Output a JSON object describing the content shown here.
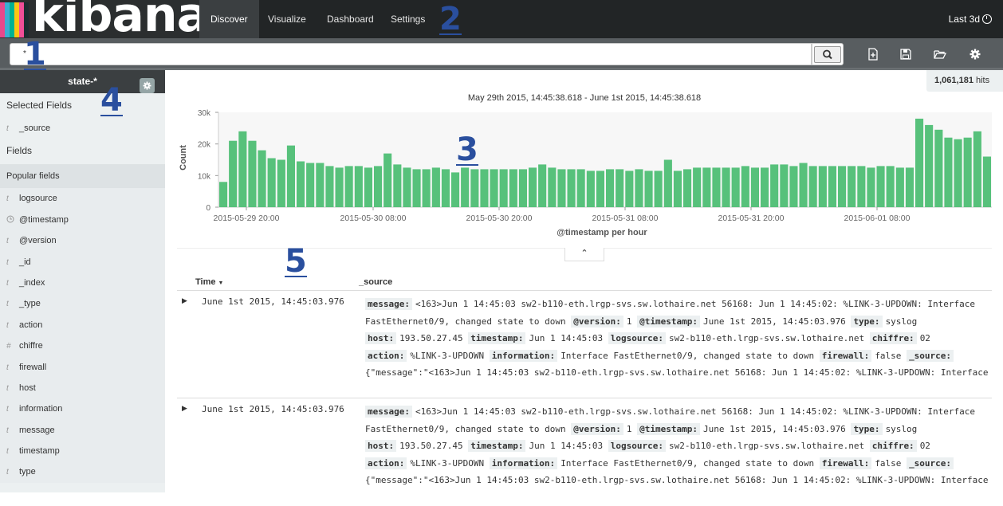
{
  "nav": {
    "logo": "kibana",
    "logo_colors": [
      "#e8488b",
      "#3caed2",
      "#00b294",
      "#fec514",
      "#f04e98",
      "#1e2b31"
    ],
    "tabs": [
      "Discover",
      "Visualize",
      "Dashboard",
      "Settings"
    ],
    "active_tab": "Discover",
    "time_range": "Last 3d"
  },
  "search": {
    "query": "*",
    "button_icon": "search-icon"
  },
  "toolbar": {
    "icons": [
      "new-document-icon",
      "save-icon",
      "open-folder-icon",
      "gear-icon"
    ]
  },
  "sidebar": {
    "index_pattern": "state-*",
    "selected_fields_label": "Selected Fields",
    "selected_fields": [
      {
        "type": "t",
        "name": "_source"
      }
    ],
    "fields_label": "Fields",
    "popular_label": "Popular fields",
    "popular_fields": [
      {
        "type": "t",
        "name": "logsource"
      },
      {
        "type": "clock",
        "name": "@timestamp"
      },
      {
        "type": "t",
        "name": "@version"
      },
      {
        "type": "t",
        "name": "_id"
      },
      {
        "type": "t",
        "name": "_index"
      },
      {
        "type": "t",
        "name": "_type"
      },
      {
        "type": "t",
        "name": "action"
      },
      {
        "type": "#",
        "name": "chiffre"
      },
      {
        "type": "t",
        "name": "firewall"
      },
      {
        "type": "t",
        "name": "host"
      },
      {
        "type": "t",
        "name": "information"
      },
      {
        "type": "t",
        "name": "message"
      },
      {
        "type": "t",
        "name": "timestamp"
      },
      {
        "type": "t",
        "name": "type"
      }
    ]
  },
  "hits": {
    "count": "1,061,181",
    "label": "hits"
  },
  "annotations": [
    "1",
    "2",
    "3",
    "4",
    "5"
  ],
  "chart_data": {
    "type": "bar",
    "title": "May 29th 2015, 14:45:38.618 - June 1st 2015, 14:45:38.618",
    "xlabel": "@timestamp per hour",
    "ylabel": "Count",
    "yticks": [
      "0",
      "10k",
      "20k",
      "30k"
    ],
    "ylim": [
      0,
      30000
    ],
    "xticks": [
      "2015-05-29 20:00",
      "2015-05-30 08:00",
      "2015-05-30 20:00",
      "2015-05-31 08:00",
      "2015-05-31 20:00",
      "2015-06-01 08:00"
    ],
    "bar_color": "#57c17b",
    "values": [
      8000,
      21000,
      24000,
      21000,
      18000,
      15500,
      15000,
      19500,
      14500,
      14000,
      14000,
      13000,
      12500,
      13000,
      13000,
      12500,
      13000,
      17000,
      13500,
      12500,
      12000,
      12000,
      12500,
      12000,
      11000,
      12500,
      12000,
      12000,
      12000,
      12000,
      12000,
      12000,
      12500,
      13500,
      12500,
      12000,
      12000,
      12000,
      11500,
      11500,
      12000,
      12000,
      11500,
      12000,
      11500,
      11500,
      15000,
      11500,
      12000,
      12500,
      12500,
      12500,
      12500,
      12500,
      13000,
      12500,
      12500,
      13500,
      13500,
      13000,
      14000,
      13000,
      13000,
      13000,
      13000,
      13000,
      13000,
      12500,
      13000,
      13000,
      12500,
      12500,
      28000,
      26000,
      24500,
      22000,
      21500,
      22000,
      24000,
      16000
    ]
  },
  "table": {
    "headers": {
      "time": "Time",
      "source": "_source"
    },
    "rows": [
      {
        "time": "June 1st 2015, 14:45:03.976",
        "lines": [
          [
            [
              "message:",
              "<163>Jun 1 14:45:03 sw2-b110-eth.lrgp-svs.sw.lothaire.net 56168: Jun 1 14:45:02: %LINK-3-UPDOWN: Interface"
            ]
          ],
          [
            [
              "",
              "FastEthernet0/9, changed state to down"
            ],
            [
              "@version:",
              "1"
            ],
            [
              "@timestamp:",
              "June 1st 2015, 14:45:03.976"
            ],
            [
              "type:",
              "syslog"
            ]
          ],
          [
            [
              "host:",
              "193.50.27.45"
            ],
            [
              "timestamp:",
              "Jun 1 14:45:03"
            ],
            [
              "logsource:",
              "sw2-b110-eth.lrgp-svs.sw.lothaire.net"
            ],
            [
              "chiffre:",
              "02"
            ]
          ],
          [
            [
              "action:",
              "%LINK-3-UPDOWN"
            ],
            [
              "information:",
              "Interface FastEthernet0/9, changed state to down"
            ],
            [
              "firewall:",
              "false"
            ],
            [
              "_source:",
              ""
            ]
          ],
          [
            [
              "",
              "{\"message\":\"<163>Jun 1 14:45:03 sw2-b110-eth.lrgp-svs.sw.lothaire.net 56168: Jun 1 14:45:02: %LINK-3-UPDOWN: Interface"
            ]
          ]
        ]
      },
      {
        "time": "June 1st 2015, 14:45:03.976",
        "lines": [
          [
            [
              "message:",
              "<163>Jun 1 14:45:03 sw2-b110-eth.lrgp-svs.sw.lothaire.net 56168: Jun 1 14:45:02: %LINK-3-UPDOWN: Interface"
            ]
          ],
          [
            [
              "",
              "FastEthernet0/9, changed state to down"
            ],
            [
              "@version:",
              "1"
            ],
            [
              "@timestamp:",
              "June 1st 2015, 14:45:03.976"
            ],
            [
              "type:",
              "syslog"
            ]
          ],
          [
            [
              "host:",
              "193.50.27.45"
            ],
            [
              "timestamp:",
              "Jun 1 14:45:03"
            ],
            [
              "logsource:",
              "sw2-b110-eth.lrgp-svs.sw.lothaire.net"
            ],
            [
              "chiffre:",
              "02"
            ]
          ],
          [
            [
              "action:",
              "%LINK-3-UPDOWN"
            ],
            [
              "information:",
              "Interface FastEthernet0/9, changed state to down"
            ],
            [
              "firewall:",
              "false"
            ],
            [
              "_source:",
              ""
            ]
          ],
          [
            [
              "",
              "{\"message\":\"<163>Jun 1 14:45:03 sw2-b110-eth.lrgp-svs.sw.lothaire.net 56168: Jun 1 14:45:02: %LINK-3-UPDOWN: Interface"
            ]
          ]
        ]
      }
    ]
  }
}
